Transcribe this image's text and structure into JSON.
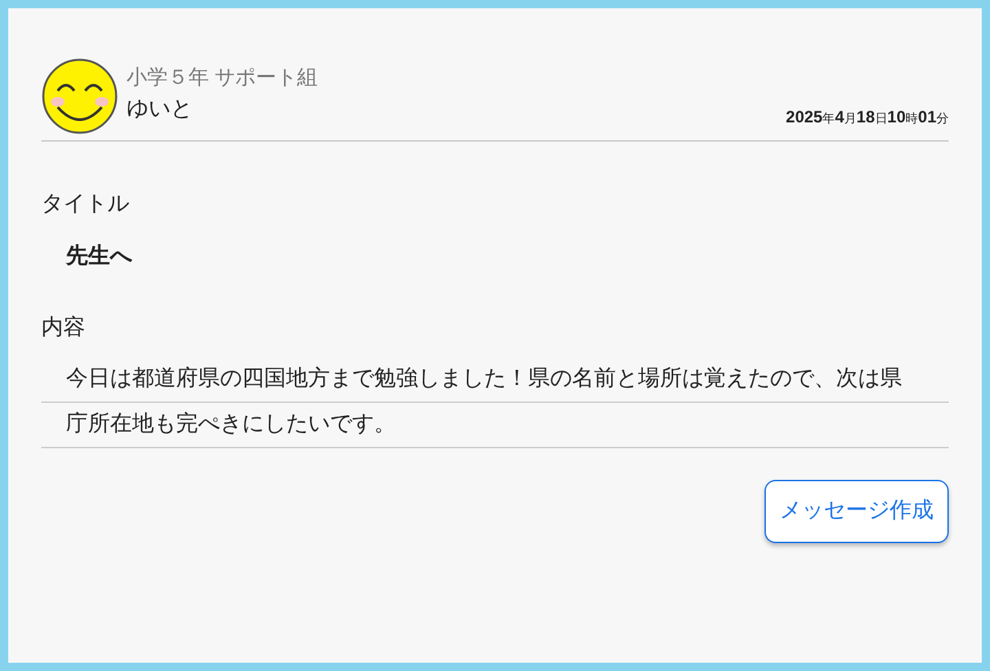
{
  "header": {
    "group": "小学５年 サポート組",
    "name": "ゆいと",
    "date_parts": [
      {
        "value": "2025",
        "unit": "年"
      },
      {
        "value": "4",
        "unit": "月"
      },
      {
        "value": "18",
        "unit": "日"
      },
      {
        "value": "10",
        "unit": "時"
      },
      {
        "value": "01",
        "unit": "分"
      }
    ]
  },
  "title_label": "タイトル",
  "title": "先生へ",
  "content_label": "内容",
  "content": "今日は都道府県の四国地方まで勉強しました！県の名前と場所は覚えたので、次は県庁所在地も完ぺきにしたいです。",
  "button": "メッセージ作成"
}
